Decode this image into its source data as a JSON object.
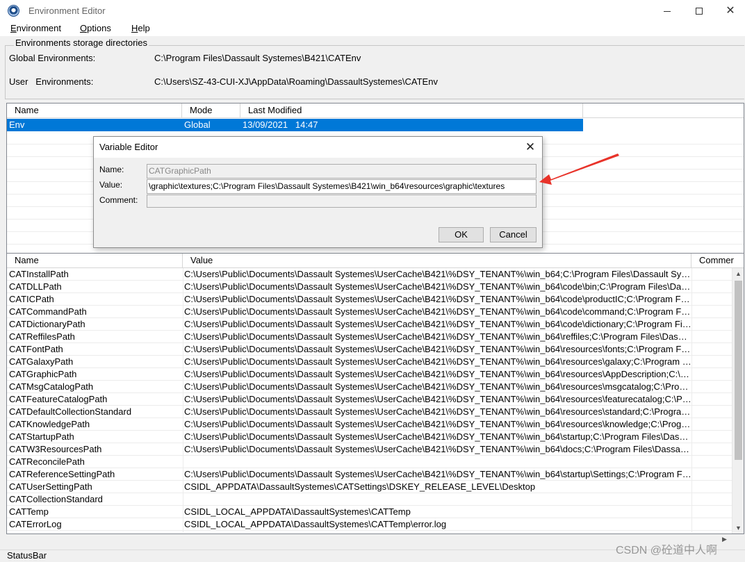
{
  "window": {
    "title": "Environment Editor",
    "minimize_icon": "minimize-icon",
    "maximize_icon": "maximize-icon",
    "close_icon": "close-icon"
  },
  "menu": [
    "Environment",
    "Options",
    "Help"
  ],
  "storage": {
    "legend": "Environments storage directories",
    "global_label": "Global Environments:",
    "global_value": "C:\\Program Files\\Dassault Systemes\\B421\\CATEnv",
    "user_label": "User   Environments:",
    "user_value": "C:\\Users\\SZ-43-CUI-XJ\\AppData\\Roaming\\DassaultSystemes\\CATEnv"
  },
  "env_table": {
    "columns": [
      "Name",
      "Mode",
      "Last Modified"
    ],
    "rows": [
      {
        "name": "Env",
        "mode": "Global",
        "modified": "13/09/2021   14:47"
      }
    ],
    "selection_color": "#0078d7"
  },
  "dialog": {
    "title": "Variable Editor",
    "name_label": "Name:",
    "name_value": "CATGraphicPath",
    "value_label": "Value:",
    "value_value": "\\graphic\\textures;C:\\Program Files\\Dassault Systemes\\B421\\win_b64\\resources\\graphic\\textures",
    "comment_label": "Comment:",
    "comment_value": "",
    "ok": "OK",
    "cancel": "Cancel"
  },
  "var_table": {
    "columns": [
      "Name",
      "Value",
      "Commer"
    ],
    "rows": [
      {
        "name": "CATInstallPath",
        "value": "C:\\Users\\Public\\Documents\\Dassault Systemes\\UserCache\\B421\\%DSY_TENANT%\\win_b64;C:\\Program Files\\Dassault Syste..."
      },
      {
        "name": "CATDLLPath",
        "value": "C:\\Users\\Public\\Documents\\Dassault Systemes\\UserCache\\B421\\%DSY_TENANT%\\win_b64\\code\\bin;C:\\Program Files\\Dass..."
      },
      {
        "name": "CATICPath",
        "value": "C:\\Users\\Public\\Documents\\Dassault Systemes\\UserCache\\B421\\%DSY_TENANT%\\win_b64\\code\\productIC;C:\\Program File..."
      },
      {
        "name": "CATCommandPath",
        "value": "C:\\Users\\Public\\Documents\\Dassault Systemes\\UserCache\\B421\\%DSY_TENANT%\\win_b64\\code\\command;C:\\Program File..."
      },
      {
        "name": "CATDictionaryPath",
        "value": "C:\\Users\\Public\\Documents\\Dassault Systemes\\UserCache\\B421\\%DSY_TENANT%\\win_b64\\code\\dictionary;C:\\Program File..."
      },
      {
        "name": "CATReffilesPath",
        "value": "C:\\Users\\Public\\Documents\\Dassault Systemes\\UserCache\\B421\\%DSY_TENANT%\\win_b64\\reffiles;C:\\Program Files\\Dassaul..."
      },
      {
        "name": "CATFontPath",
        "value": "C:\\Users\\Public\\Documents\\Dassault Systemes\\UserCache\\B421\\%DSY_TENANT%\\win_b64\\resources\\fonts;C:\\Program File..."
      },
      {
        "name": "CATGalaxyPath",
        "value": "C:\\Users\\Public\\Documents\\Dassault Systemes\\UserCache\\B421\\%DSY_TENANT%\\win_b64\\resources\\galaxy;C:\\Program Fil..."
      },
      {
        "name": "CATGraphicPath",
        "value": "C:\\Users\\Public\\Documents\\Dassault Systemes\\UserCache\\B421\\%DSY_TENANT%\\win_b64\\resources\\AppDescription;C:\\Pr..."
      },
      {
        "name": "CATMsgCatalogPath",
        "value": "C:\\Users\\Public\\Documents\\Dassault Systemes\\UserCache\\B421\\%DSY_TENANT%\\win_b64\\resources\\msgcatalog;C:\\Progr..."
      },
      {
        "name": "CATFeatureCatalogPath",
        "value": "C:\\Users\\Public\\Documents\\Dassault Systemes\\UserCache\\B421\\%DSY_TENANT%\\win_b64\\resources\\featurecatalog;C:\\Pro..."
      },
      {
        "name": "CATDefaultCollectionStandard",
        "value": "C:\\Users\\Public\\Documents\\Dassault Systemes\\UserCache\\B421\\%DSY_TENANT%\\win_b64\\resources\\standard;C:\\Program ..."
      },
      {
        "name": "CATKnowledgePath",
        "value": "C:\\Users\\Public\\Documents\\Dassault Systemes\\UserCache\\B421\\%DSY_TENANT%\\win_b64\\resources\\knowledge;C:\\Progra..."
      },
      {
        "name": "CATStartupPath",
        "value": "C:\\Users\\Public\\Documents\\Dassault Systemes\\UserCache\\B421\\%DSY_TENANT%\\win_b64\\startup;C:\\Program Files\\Dassau..."
      },
      {
        "name": "CATW3ResourcesPath",
        "value": "C:\\Users\\Public\\Documents\\Dassault Systemes\\UserCache\\B421\\%DSY_TENANT%\\win_b64\\docs;C:\\Program Files\\Dassault ..."
      },
      {
        "name": "CATReconcilePath",
        "value": ""
      },
      {
        "name": "CATReferenceSettingPath",
        "value": "C:\\Users\\Public\\Documents\\Dassault Systemes\\UserCache\\B421\\%DSY_TENANT%\\win_b64\\startup\\Settings;C:\\Program File..."
      },
      {
        "name": "CATUserSettingPath",
        "value": "CSIDL_APPDATA\\DassaultSystemes\\CATSettings\\DSKEY_RELEASE_LEVEL\\Desktop"
      },
      {
        "name": "CATCollectionStandard",
        "value": ""
      },
      {
        "name": "CATTemp",
        "value": "CSIDL_LOCAL_APPDATA\\DassaultSystemes\\CATTemp"
      },
      {
        "name": "CATErrorLog",
        "value": "CSIDL_LOCAL_APPDATA\\DassaultSystemes\\CATTemp\\error.log"
      }
    ]
  },
  "status": {
    "text": "StatusBar"
  },
  "watermark": "CSDN @砼道中人啊",
  "annotation": {
    "color": "#e8332a",
    "icon": "red-arrow-icon"
  }
}
